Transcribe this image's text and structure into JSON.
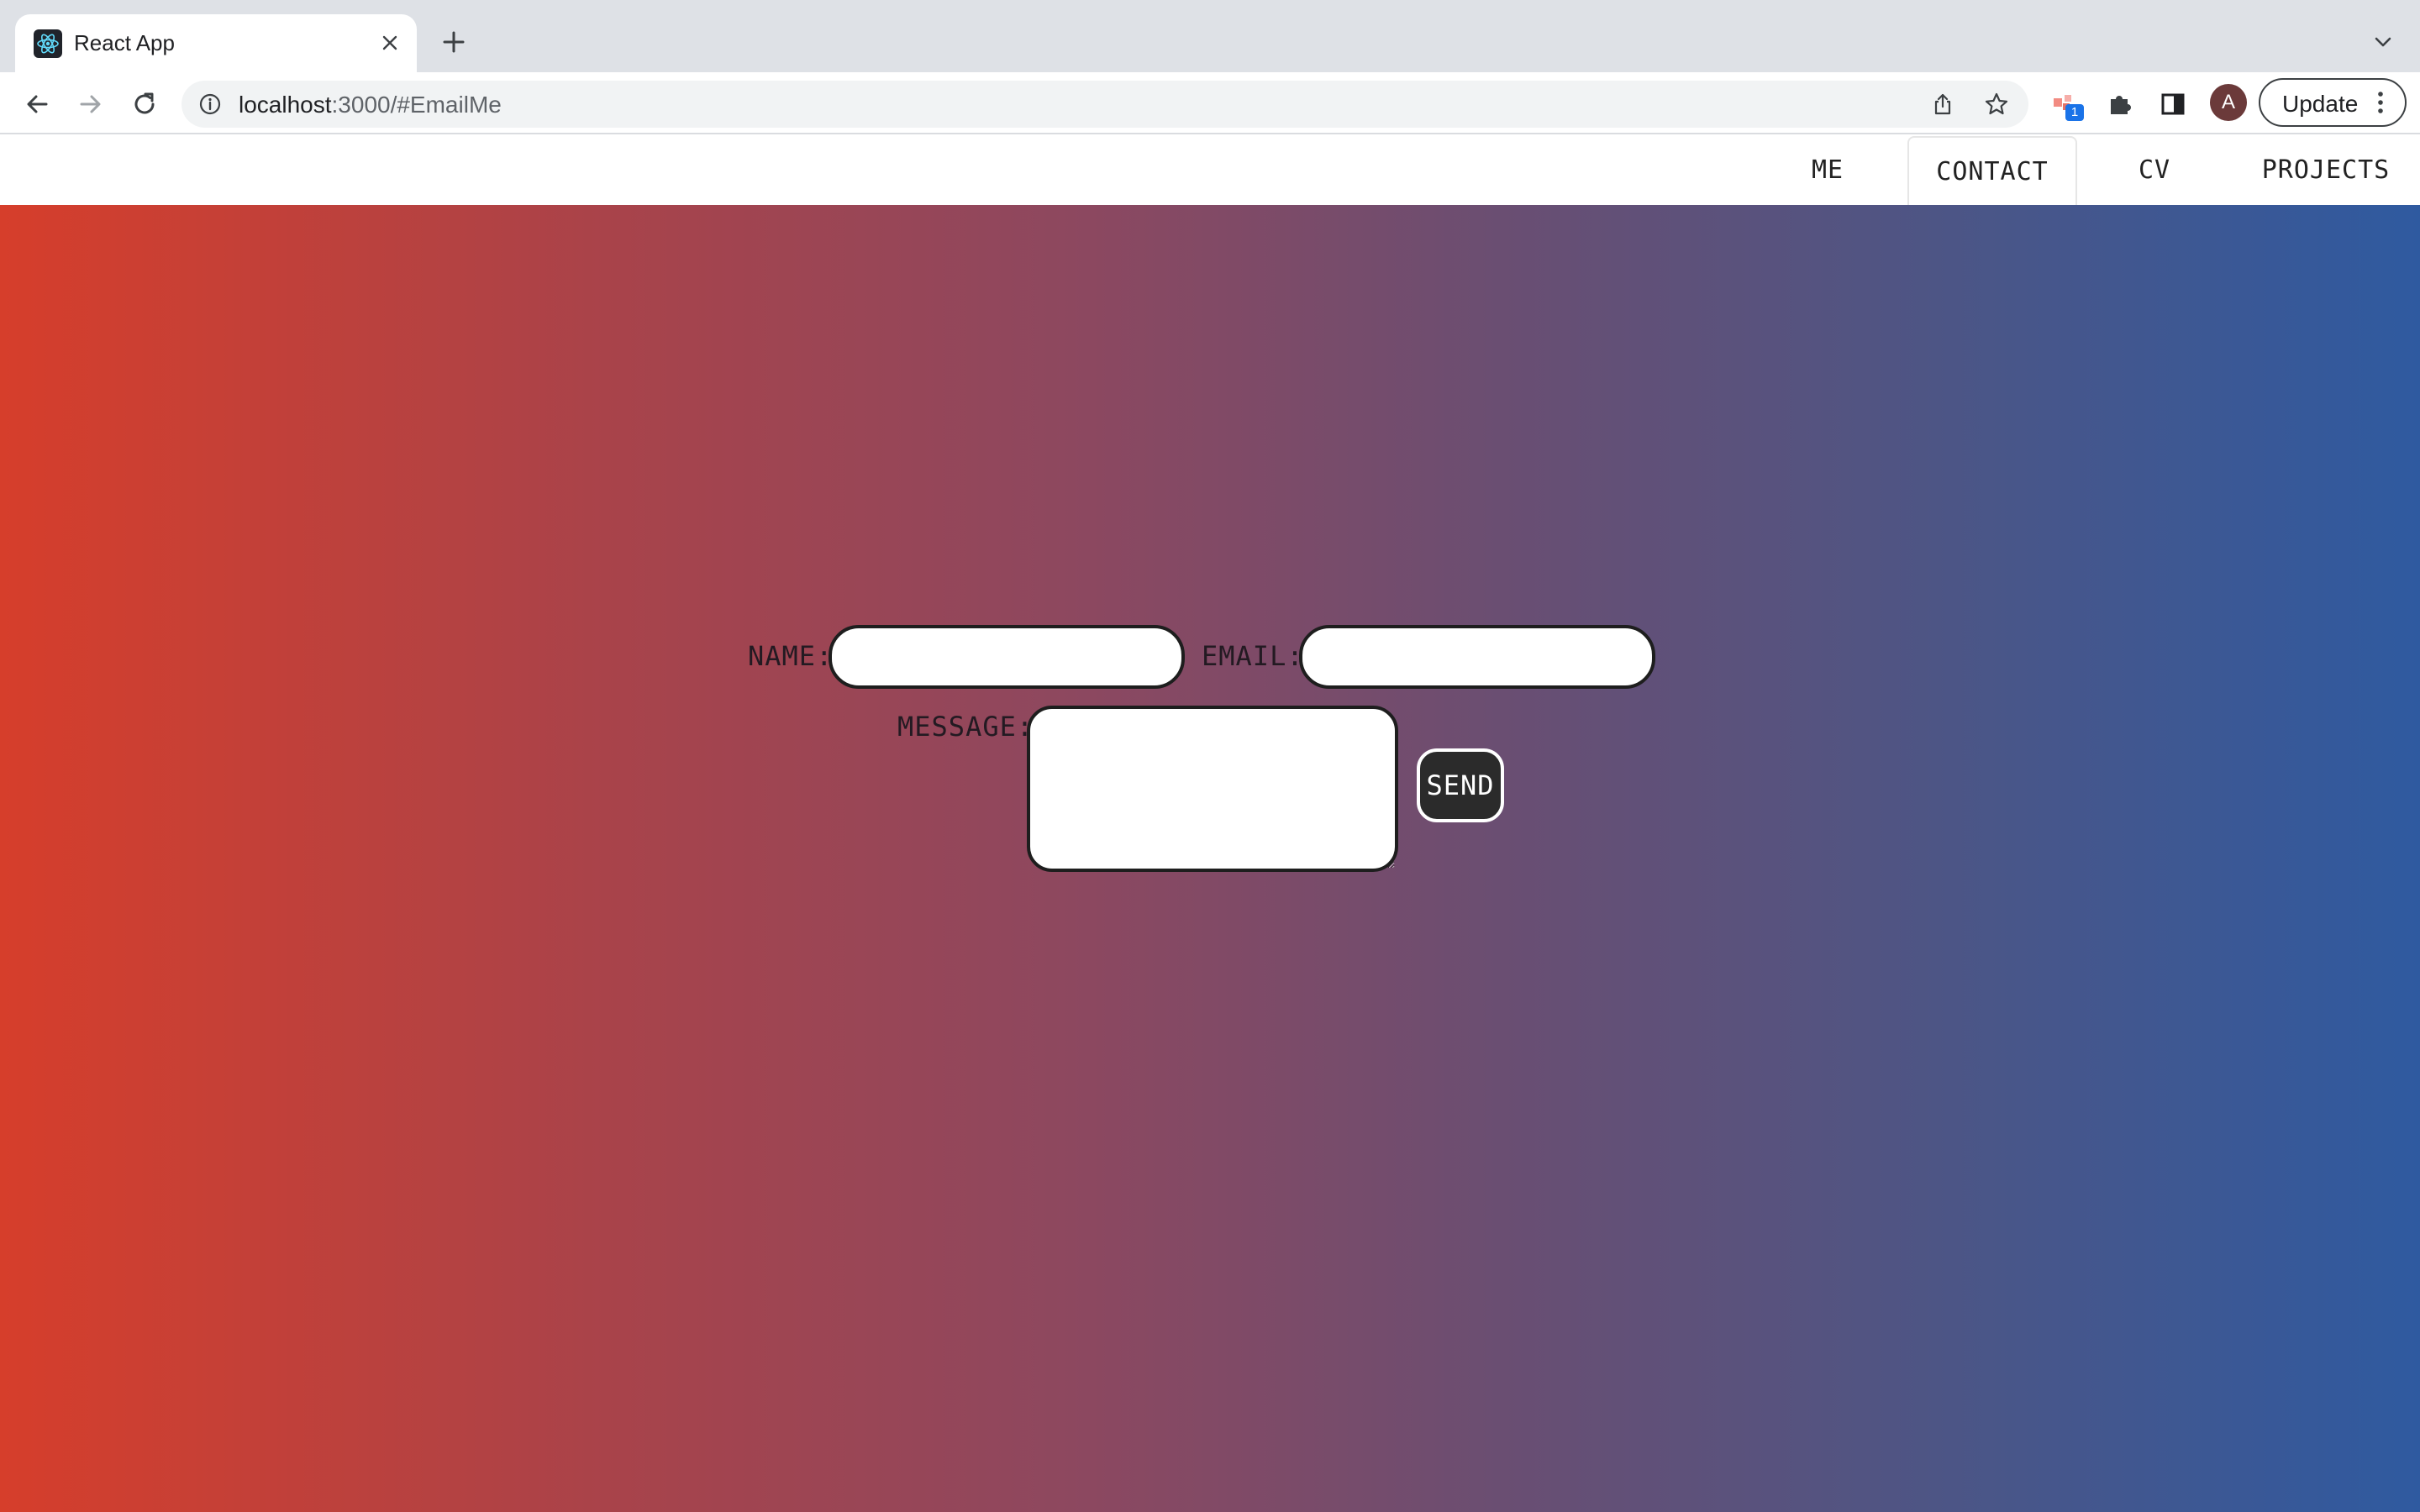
{
  "browser": {
    "tab_title": "React App",
    "tab_favicon": "react-logo-icon",
    "url_host": "localhost",
    "url_rest": ":3000/#EmailMe",
    "extension_badge": "1",
    "avatar_letter": "A",
    "update_label": "Update"
  },
  "nav": {
    "items": [
      {
        "label": "ME"
      },
      {
        "label": "CONTACT"
      },
      {
        "label": "CV"
      },
      {
        "label": "PROJECTS"
      }
    ],
    "active": "CONTACT"
  },
  "form": {
    "name_label": "NAME:",
    "name_value": "",
    "email_label": "EMAIL:",
    "email_value": "",
    "message_label": "MESSAGE:",
    "message_value": "",
    "send_label": "SEND"
  },
  "colors": {
    "gradient_left": "#d63e2b",
    "gradient_right": "#2f5aa0",
    "button_bg": "#2b2b2b"
  }
}
